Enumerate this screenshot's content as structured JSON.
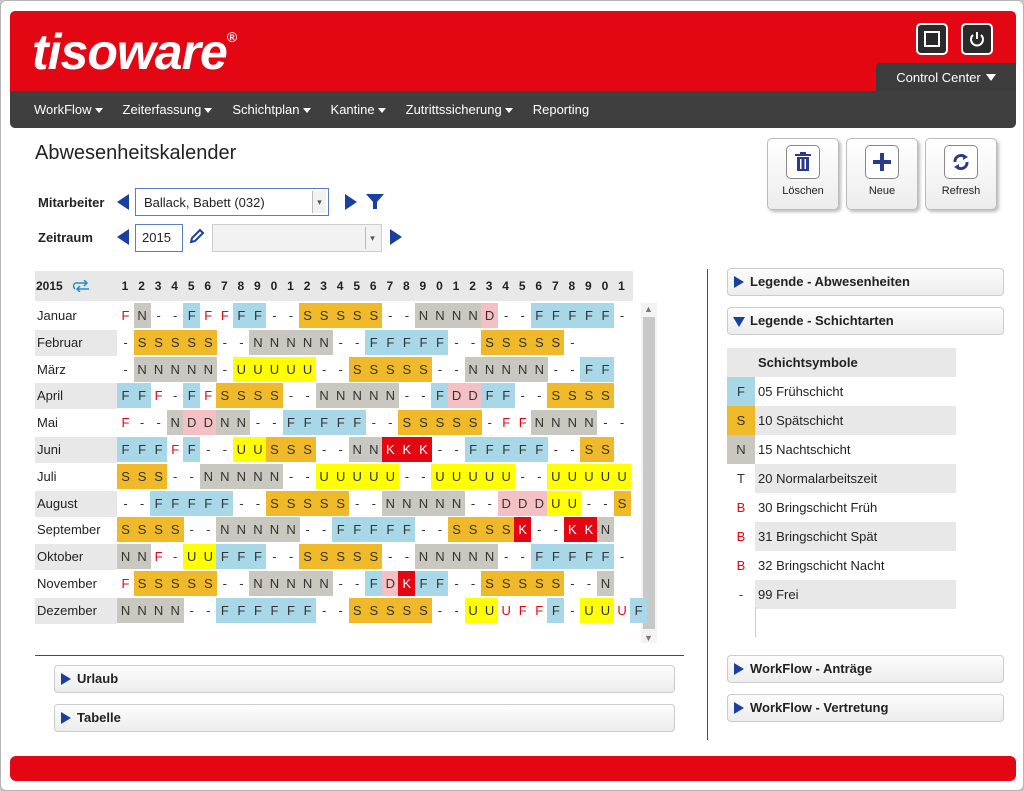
{
  "brand": {
    "name": "tisoware",
    "reg": "®"
  },
  "header": {
    "control_center": "Control Center"
  },
  "nav": {
    "items": [
      "WorkFlow",
      "Zeiterfassung",
      "Schichtplan",
      "Kantine",
      "Zutrittssicherung",
      "Reporting"
    ],
    "dropdown": [
      true,
      true,
      true,
      true,
      true,
      false
    ]
  },
  "page": {
    "title": "Abwesenheitskalender"
  },
  "actions": {
    "delete": "Löschen",
    "new": "Neue",
    "refresh": "Refresh"
  },
  "filter": {
    "employee_label": "Mitarbeiter",
    "employee_value": "Ballack, Babett (032)",
    "period_label": "Zeitraum",
    "period_value": "2015"
  },
  "calendar": {
    "year": "2015",
    "days": [
      "1",
      "2",
      "3",
      "4",
      "5",
      "6",
      "7",
      "8",
      "9",
      "0",
      "1",
      "2",
      "3",
      "4",
      "5",
      "6",
      "7",
      "8",
      "9",
      "0",
      "1",
      "2",
      "3",
      "4",
      "5",
      "6",
      "7",
      "8",
      "9",
      "0",
      "1"
    ],
    "months": [
      {
        "name": "Januar",
        "cells": "FN--FFFFF--SSSSS--NNNND--FFFFF-"
      },
      {
        "name": "Februar",
        "cells": "-SSSSS--NNNNN--FFFFF--SSSSS-"
      },
      {
        "name": "März",
        "cells": "-NNNNN-UUUUU--SSSSS--NNNNN--FF"
      },
      {
        "name": "April",
        "cells": "FFF-FFSSSS--NNNNN--FDDFF--SSSS"
      },
      {
        "name": "Mai",
        "cells": "F--NDDNN--FFFFF--SSSSS-FFNNNN--"
      },
      {
        "name": "Juni",
        "cells": "FFFFF--UUSSS--NNKKK--FFFFF--SS"
      },
      {
        "name": "Juli",
        "cells": "SSS--NNNNN--UUUUU--UUUUU--UUUUU"
      },
      {
        "name": "August",
        "cells": "--FFFFF--SSSSS--NNNNN--DDDUU--S"
      },
      {
        "name": "September",
        "cells": "SSSS--NNNNN--FFFFF--SSSSK--KKN"
      },
      {
        "name": "Oktober",
        "cells": "NNF-UUFFF--SSSSS--NNNNN--FFFFF-"
      },
      {
        "name": "November",
        "cells": "FSSSSS--NNNNN--FDKFF--SSSSS--N"
      },
      {
        "name": "Dezember",
        "cells": "NNNN--FFFFFF--SSSSS--UUUFFF-UUUF"
      }
    ],
    "red_cells": {
      "Januar": [
        0,
        5,
        6
      ],
      "April": [
        2,
        5
      ],
      "Mai": [
        0,
        23,
        24
      ],
      "Juni": [
        3
      ],
      "Oktober": [
        2
      ],
      "November": [
        0
      ],
      "Dezember": [
        23,
        24,
        25,
        30
      ]
    }
  },
  "panels": {
    "vacation": "Urlaub",
    "table": "Tabelle"
  },
  "right": {
    "legend_absence": "Legende - Abwesenheiten",
    "legend_shift": "Legende - Schichtarten",
    "wf_requests": "WorkFlow - Anträge",
    "wf_substitution": "WorkFlow - Vertretung"
  },
  "legend": {
    "header": "Schichtsymbole",
    "items": [
      {
        "sym": "F",
        "label": "05 Frühschicht",
        "bg": "#a8d8e8",
        "color": "#333"
      },
      {
        "sym": "S",
        "label": "10 Spätschicht",
        "bg": "#f0b929",
        "color": "#333"
      },
      {
        "sym": "N",
        "label": "15 Nachtschicht",
        "bg": "#c8c8c0",
        "color": "#333"
      },
      {
        "sym": "T",
        "label": "20 Normalarbeitszeit",
        "bg": "#ffffff",
        "color": "#333"
      },
      {
        "sym": "B",
        "label": "30 Bringschicht Früh",
        "bg": "#ffffff",
        "color": "#e30613"
      },
      {
        "sym": "B",
        "label": "31 Bringschicht Spät",
        "bg": "#ffffff",
        "color": "#e30613"
      },
      {
        "sym": "B",
        "label": "32 Bringschicht Nacht",
        "bg": "#ffffff",
        "color": "#e30613"
      },
      {
        "sym": "-",
        "label": "99 Frei",
        "bg": "#ffffff",
        "color": "#333"
      }
    ]
  },
  "colors": {
    "F": "#a8d8e8",
    "S": "#f0b929",
    "N": "#c8c8c0",
    "U": "#ffff00",
    "K": "#e30613",
    "D": "#f4c0c4",
    "brand_red": "#e30613"
  }
}
